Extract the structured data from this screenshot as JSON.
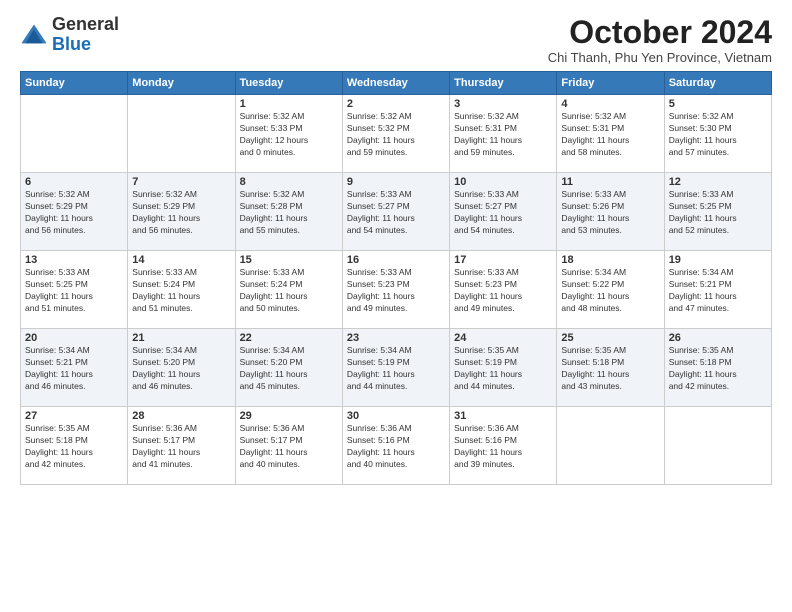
{
  "header": {
    "logo": {
      "general": "General",
      "blue": "Blue"
    },
    "title": "October 2024",
    "location": "Chi Thanh, Phu Yen Province, Vietnam"
  },
  "days_of_week": [
    "Sunday",
    "Monday",
    "Tuesday",
    "Wednesday",
    "Thursday",
    "Friday",
    "Saturday"
  ],
  "weeks": [
    [
      {
        "day": "",
        "content": ""
      },
      {
        "day": "",
        "content": ""
      },
      {
        "day": "1",
        "content": "Sunrise: 5:32 AM\nSunset: 5:33 PM\nDaylight: 12 hours\nand 0 minutes."
      },
      {
        "day": "2",
        "content": "Sunrise: 5:32 AM\nSunset: 5:32 PM\nDaylight: 11 hours\nand 59 minutes."
      },
      {
        "day": "3",
        "content": "Sunrise: 5:32 AM\nSunset: 5:31 PM\nDaylight: 11 hours\nand 59 minutes."
      },
      {
        "day": "4",
        "content": "Sunrise: 5:32 AM\nSunset: 5:31 PM\nDaylight: 11 hours\nand 58 minutes."
      },
      {
        "day": "5",
        "content": "Sunrise: 5:32 AM\nSunset: 5:30 PM\nDaylight: 11 hours\nand 57 minutes."
      }
    ],
    [
      {
        "day": "6",
        "content": "Sunrise: 5:32 AM\nSunset: 5:29 PM\nDaylight: 11 hours\nand 56 minutes."
      },
      {
        "day": "7",
        "content": "Sunrise: 5:32 AM\nSunset: 5:29 PM\nDaylight: 11 hours\nand 56 minutes."
      },
      {
        "day": "8",
        "content": "Sunrise: 5:32 AM\nSunset: 5:28 PM\nDaylight: 11 hours\nand 55 minutes."
      },
      {
        "day": "9",
        "content": "Sunrise: 5:33 AM\nSunset: 5:27 PM\nDaylight: 11 hours\nand 54 minutes."
      },
      {
        "day": "10",
        "content": "Sunrise: 5:33 AM\nSunset: 5:27 PM\nDaylight: 11 hours\nand 54 minutes."
      },
      {
        "day": "11",
        "content": "Sunrise: 5:33 AM\nSunset: 5:26 PM\nDaylight: 11 hours\nand 53 minutes."
      },
      {
        "day": "12",
        "content": "Sunrise: 5:33 AM\nSunset: 5:25 PM\nDaylight: 11 hours\nand 52 minutes."
      }
    ],
    [
      {
        "day": "13",
        "content": "Sunrise: 5:33 AM\nSunset: 5:25 PM\nDaylight: 11 hours\nand 51 minutes."
      },
      {
        "day": "14",
        "content": "Sunrise: 5:33 AM\nSunset: 5:24 PM\nDaylight: 11 hours\nand 51 minutes."
      },
      {
        "day": "15",
        "content": "Sunrise: 5:33 AM\nSunset: 5:24 PM\nDaylight: 11 hours\nand 50 minutes."
      },
      {
        "day": "16",
        "content": "Sunrise: 5:33 AM\nSunset: 5:23 PM\nDaylight: 11 hours\nand 49 minutes."
      },
      {
        "day": "17",
        "content": "Sunrise: 5:33 AM\nSunset: 5:23 PM\nDaylight: 11 hours\nand 49 minutes."
      },
      {
        "day": "18",
        "content": "Sunrise: 5:34 AM\nSunset: 5:22 PM\nDaylight: 11 hours\nand 48 minutes."
      },
      {
        "day": "19",
        "content": "Sunrise: 5:34 AM\nSunset: 5:21 PM\nDaylight: 11 hours\nand 47 minutes."
      }
    ],
    [
      {
        "day": "20",
        "content": "Sunrise: 5:34 AM\nSunset: 5:21 PM\nDaylight: 11 hours\nand 46 minutes."
      },
      {
        "day": "21",
        "content": "Sunrise: 5:34 AM\nSunset: 5:20 PM\nDaylight: 11 hours\nand 46 minutes."
      },
      {
        "day": "22",
        "content": "Sunrise: 5:34 AM\nSunset: 5:20 PM\nDaylight: 11 hours\nand 45 minutes."
      },
      {
        "day": "23",
        "content": "Sunrise: 5:34 AM\nSunset: 5:19 PM\nDaylight: 11 hours\nand 44 minutes."
      },
      {
        "day": "24",
        "content": "Sunrise: 5:35 AM\nSunset: 5:19 PM\nDaylight: 11 hours\nand 44 minutes."
      },
      {
        "day": "25",
        "content": "Sunrise: 5:35 AM\nSunset: 5:18 PM\nDaylight: 11 hours\nand 43 minutes."
      },
      {
        "day": "26",
        "content": "Sunrise: 5:35 AM\nSunset: 5:18 PM\nDaylight: 11 hours\nand 42 minutes."
      }
    ],
    [
      {
        "day": "27",
        "content": "Sunrise: 5:35 AM\nSunset: 5:18 PM\nDaylight: 11 hours\nand 42 minutes."
      },
      {
        "day": "28",
        "content": "Sunrise: 5:36 AM\nSunset: 5:17 PM\nDaylight: 11 hours\nand 41 minutes."
      },
      {
        "day": "29",
        "content": "Sunrise: 5:36 AM\nSunset: 5:17 PM\nDaylight: 11 hours\nand 40 minutes."
      },
      {
        "day": "30",
        "content": "Sunrise: 5:36 AM\nSunset: 5:16 PM\nDaylight: 11 hours\nand 40 minutes."
      },
      {
        "day": "31",
        "content": "Sunrise: 5:36 AM\nSunset: 5:16 PM\nDaylight: 11 hours\nand 39 minutes."
      },
      {
        "day": "",
        "content": ""
      },
      {
        "day": "",
        "content": ""
      }
    ]
  ]
}
